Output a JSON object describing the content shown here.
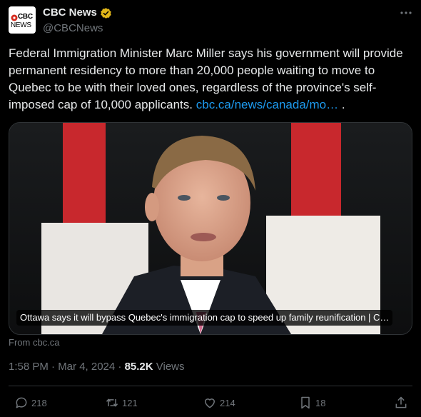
{
  "account": {
    "display_name": "CBC News",
    "handle": "@CBCNews",
    "logo_text_top": "CBC",
    "logo_text_bottom": "NEWS"
  },
  "tweet": {
    "text": "Federal Immigration Minister Marc Miller says his government will provide permanent residency to more than 20,000 people waiting to move to Quebec to be with their loved ones, regardless of the province's self-imposed cap of 10,000 applicants. ",
    "link_text": "cbc.ca/news/canada/mo…",
    "trailing_text": " .",
    "card_title": "Ottawa says it will bypass Quebec's immigration cap to speed up family reunification | C…",
    "card_source": "From cbc.ca",
    "time": "1:58 PM · Mar 4, 2024 · ",
    "views_count": "85.2K",
    "views_label": " Views"
  },
  "actions": {
    "replies": "218",
    "reposts": "121",
    "likes": "214",
    "bookmarks": "18"
  },
  "icons": {
    "verified": "verified-badge-icon",
    "more": "more-icon",
    "reply": "reply-icon",
    "repost": "repost-icon",
    "like": "heart-icon",
    "bookmark": "bookmark-icon",
    "share": "share-icon"
  },
  "colors": {
    "background": "#000000",
    "text": "#e7e9ea",
    "muted": "#71767b",
    "link": "#1d9bf0",
    "verified_gold": "#e2b719",
    "cbc_red": "#d52b1e",
    "border": "#2f3336"
  }
}
